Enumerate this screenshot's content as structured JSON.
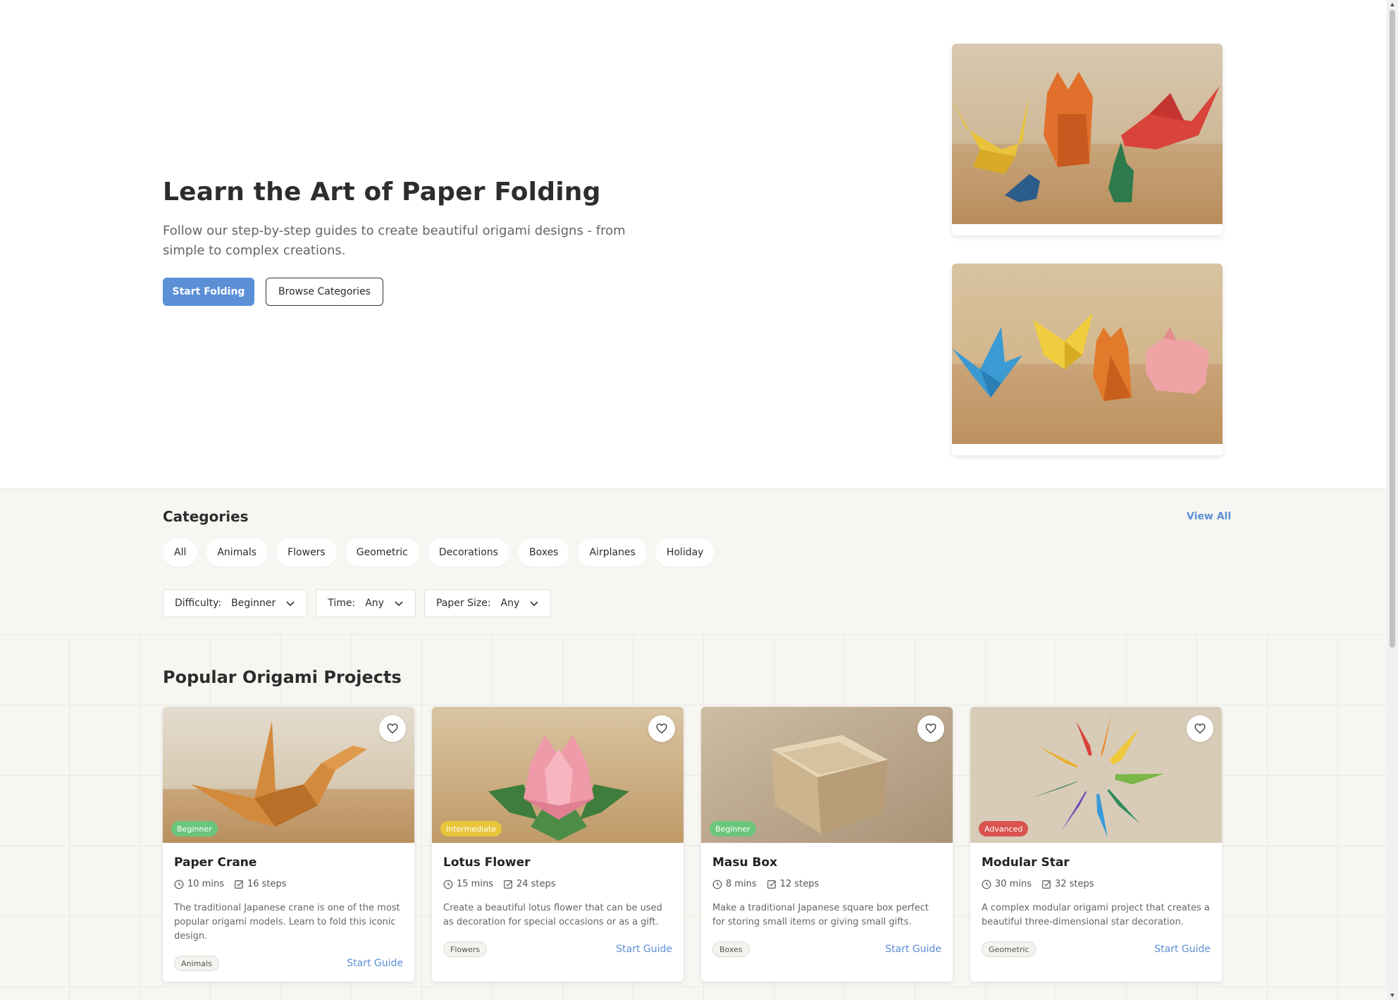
{
  "hero": {
    "title": "Learn the Art of Paper Folding",
    "subtitle": "Follow our step-by-step guides to create beautiful origami designs - from simple to complex creations.",
    "primary_button": "Start Folding",
    "secondary_button": "Browse Categories"
  },
  "categories": {
    "title": "Categories",
    "view_all": "View All",
    "pills": [
      "All",
      "Animals",
      "Flowers",
      "Geometric",
      "Decorations",
      "Boxes",
      "Airplanes",
      "Holiday"
    ],
    "filters": [
      {
        "label": "Difficulty:",
        "value": "Beginner"
      },
      {
        "label": "Time:",
        "value": "Any"
      },
      {
        "label": "Paper Size:",
        "value": "Any"
      }
    ]
  },
  "projects": {
    "title": "Popular Origami Projects",
    "cards": [
      {
        "name": "Paper Crane",
        "level": "Beginner",
        "time": "10 mins",
        "steps": "16 steps",
        "description": "The traditional Japanese crane is one of the most popular origami models. Learn to fold this iconic design.",
        "tag": "Animals",
        "cta": "Start Guide"
      },
      {
        "name": "Lotus Flower",
        "level": "Intermediate",
        "time": "15 mins",
        "steps": "24 steps",
        "description": "Create a beautiful lotus flower that can be used as decoration for special occasions or as a gift.",
        "tag": "Flowers",
        "cta": "Start Guide"
      },
      {
        "name": "Masu Box",
        "level": "Beginner",
        "time": "8 mins",
        "steps": "12 steps",
        "description": "Make a traditional Japanese square box perfect for storing small items or giving small gifts.",
        "tag": "Boxes",
        "cta": "Start Guide"
      },
      {
        "name": "Modular Star",
        "level": "Advanced",
        "time": "30 mins",
        "steps": "32 steps",
        "description": "A complex modular origami project that creates a beautiful three-dimensional star decoration.",
        "tag": "Geometric",
        "cta": "Start Guide"
      }
    ]
  },
  "colors": {
    "accent": "#5b8fd6",
    "beginner": "#6cc57c",
    "intermediate": "#e8c53a",
    "advanced": "#d9534f",
    "section_bg": "#f7f6f2"
  },
  "icons": {
    "favorite": "heart-icon",
    "time": "clock-icon",
    "steps": "checkbox-icon",
    "dropdown": "chevron-down-icon"
  }
}
